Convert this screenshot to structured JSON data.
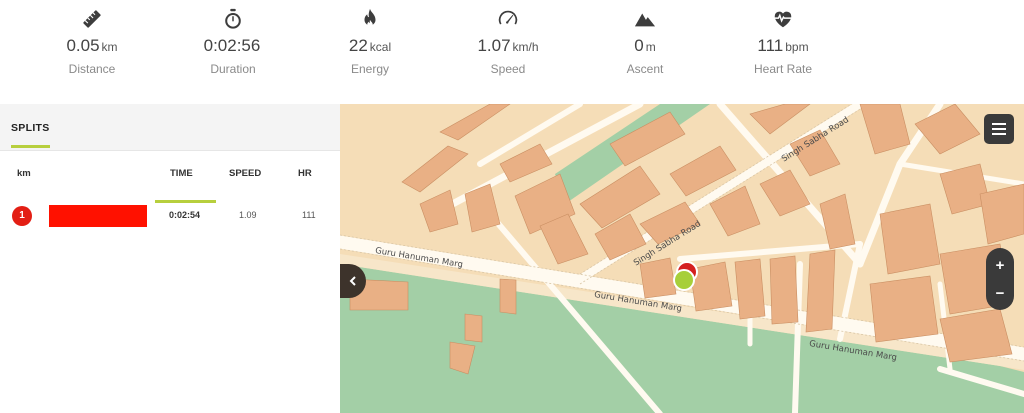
{
  "stats": [
    {
      "icon": "ruler-icon",
      "value": "0.05",
      "unit": "km",
      "label": "Distance"
    },
    {
      "icon": "stopwatch-icon",
      "value": "0:02:56",
      "unit": "",
      "label": "Duration"
    },
    {
      "icon": "flame-icon",
      "value": "22",
      "unit": "kcal",
      "label": "Energy"
    },
    {
      "icon": "speedometer-icon",
      "value": "1.07",
      "unit": "km/h",
      "label": "Speed"
    },
    {
      "icon": "mountain-icon",
      "value": "0",
      "unit": "m",
      "label": "Ascent"
    },
    {
      "icon": "heart-rate-icon",
      "value": "111",
      "unit": "bpm",
      "label": "Heart Rate"
    }
  ],
  "splits": {
    "title": "SPLITS",
    "columns": {
      "km": "km",
      "time": "TIME",
      "speed": "SPEED",
      "hr": "HR"
    },
    "rows": [
      {
        "km": "1",
        "time": "0:02:54",
        "speed": "1.09",
        "hr": "111"
      }
    ],
    "accent_color": "#b7cf3d",
    "pace_bar_color": "#ff1100"
  },
  "map": {
    "streets": {
      "guru_hanuman_1": "Guru Hanuman Marg",
      "guru_hanuman_2": "Guru Hanuman Marg",
      "guru_hanuman_3": "Guru Hanuman Marg",
      "singh_sabha_1": "Singh Sabha Road",
      "singh_sabha_2": "Singh Sabha Road"
    },
    "zoom_in": "+",
    "zoom_out": "−",
    "land_color": "#f5ddb7",
    "park_color": "#a3cfa6",
    "building_color": "#e9b085"
  }
}
